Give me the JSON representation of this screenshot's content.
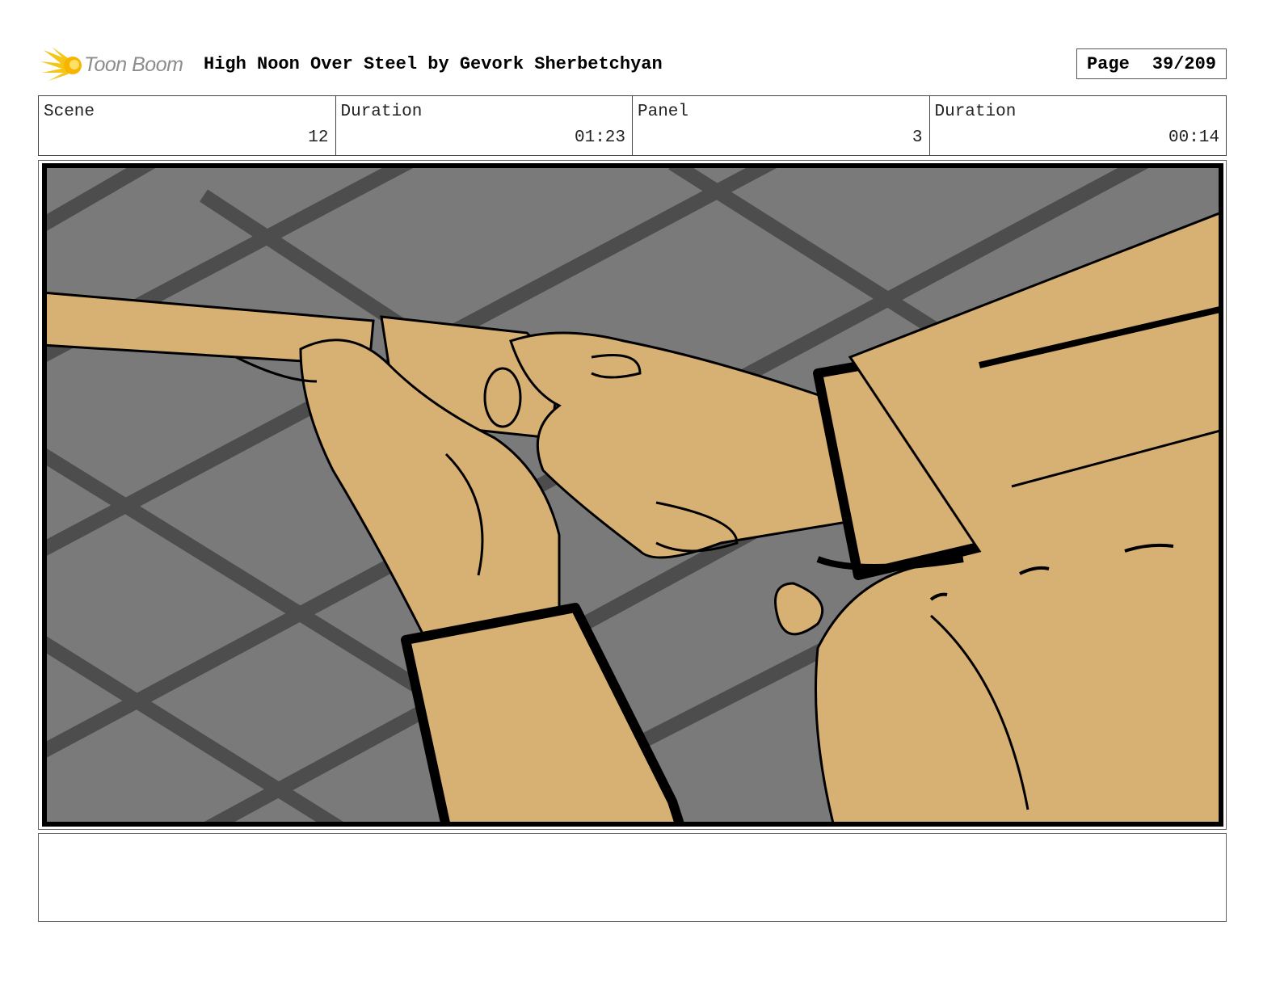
{
  "header": {
    "logo_text": "Toon Boom",
    "title": "High Noon Over Steel by Gevork Sherbetchyan",
    "page_label": "Page",
    "page_number": "39/209"
  },
  "info": {
    "scene_label": "Scene",
    "scene_value": "12",
    "scene_duration_label": "Duration",
    "scene_duration_value": "01:23",
    "panel_label": "Panel",
    "panel_value": "3",
    "panel_duration_label": "Duration",
    "panel_duration_value": "00:14"
  },
  "notes": {
    "text": ""
  },
  "colors": {
    "floor": "#7a7a7a",
    "floor_seams": "#4d4d4d",
    "skin": "#d7b073",
    "ink": "#000000",
    "logo_flare": "#f5c518"
  }
}
